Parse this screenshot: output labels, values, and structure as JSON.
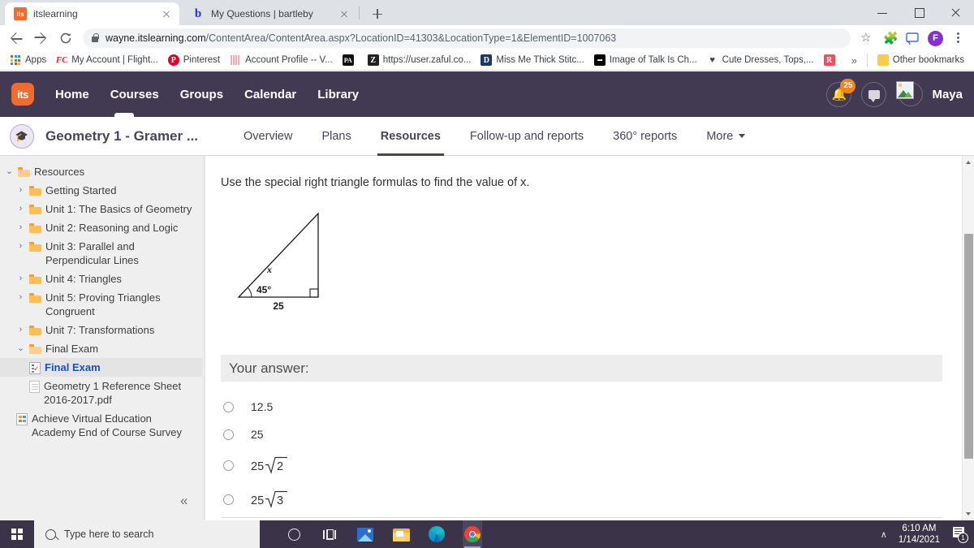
{
  "browser": {
    "tabs": [
      {
        "title": "itslearning",
        "favicon": "its-favicon",
        "active": true
      },
      {
        "title": "My Questions | bartleby",
        "favicon": "bartleby-favicon",
        "active": false
      }
    ],
    "new_tab_label": "+",
    "url_domain": "wayne.itslearning.com",
    "url_path": "/ContentArea/ContentArea.aspx?LocationID=41303&LocationType=1&ElementID=1007063",
    "profile_initial": "F",
    "bookmarks": [
      {
        "label": "Apps",
        "icon": "apps-grid-icon"
      },
      {
        "label": "My Account | Flight...",
        "icon": "fc-icon"
      },
      {
        "label": "Pinterest",
        "icon": "pinterest-icon"
      },
      {
        "label": "Account Profile -- V...",
        "icon": "stripes-icon"
      },
      {
        "label": "",
        "icon": "pa-icon"
      },
      {
        "label": "https://user.zaful.co...",
        "icon": "z-icon"
      },
      {
        "label": "Miss Me Thick Stitc...",
        "icon": "d-icon"
      },
      {
        "label": "Image of Talk Is Ch...",
        "icon": "black-icon"
      },
      {
        "label": "Cute Dresses, Tops,...",
        "icon": "v-icon"
      },
      {
        "label": "",
        "icon": "r-icon"
      }
    ],
    "overflow_label": "»",
    "other_bookmarks_label": "Other bookmarks"
  },
  "app_header": {
    "logo_text": "its",
    "nav": [
      "Home",
      "Courses",
      "Groups",
      "Calendar",
      "Library"
    ],
    "notification_count": "25",
    "username": "Maya"
  },
  "course_bar": {
    "title": "Geometry 1 - Gramer ...",
    "tabs": [
      {
        "label": "Overview",
        "active": false
      },
      {
        "label": "Plans",
        "active": false
      },
      {
        "label": "Resources",
        "active": true
      },
      {
        "label": "Follow-up and reports",
        "active": false
      },
      {
        "label": "360° reports",
        "active": false
      },
      {
        "label": "More",
        "active": false,
        "has_caret": true
      }
    ]
  },
  "sidebar": {
    "items": [
      {
        "label": "Resources",
        "level": 1,
        "type": "folder-open",
        "twisty": "⌄",
        "selected": false
      },
      {
        "label": "Getting Started",
        "level": 2,
        "type": "folder",
        "twisty": "›",
        "selected": false
      },
      {
        "label": "Unit 1: The Basics of Geometry",
        "level": 2,
        "type": "folder",
        "twisty": "›",
        "selected": false
      },
      {
        "label": "Unit 2: Reasoning and Logic",
        "level": 2,
        "type": "folder",
        "twisty": "›",
        "selected": false
      },
      {
        "label": "Unit 3: Parallel and Perpendicular Lines",
        "level": 2,
        "type": "folder",
        "twisty": "›",
        "selected": false
      },
      {
        "label": "Unit 4: Triangles",
        "level": 2,
        "type": "folder",
        "twisty": "›",
        "selected": false
      },
      {
        "label": "Unit 5: Proving Triangles Congruent",
        "level": 2,
        "type": "folder",
        "twisty": "›",
        "selected": false
      },
      {
        "label": "Unit 7: Transformations",
        "level": 2,
        "type": "folder",
        "twisty": "›",
        "selected": false
      },
      {
        "label": "Final Exam",
        "level": 2,
        "type": "folder-open",
        "twisty": "⌄",
        "selected": false
      },
      {
        "label": "Final Exam",
        "level": 3,
        "type": "quiz",
        "twisty": "",
        "selected": true,
        "link": true
      },
      {
        "label": "Geometry 1 Reference Sheet 2016-2017.pdf",
        "level": 3,
        "type": "document",
        "twisty": "",
        "selected": false
      },
      {
        "label": "Achieve Virtual Education Academy End of Course Survey",
        "level": 2,
        "type": "survey",
        "twisty": "",
        "selected": false
      }
    ],
    "collapse_icon": "«"
  },
  "question": {
    "prompt": "Use the special right triangle formulas to find the value of x.",
    "diagram": {
      "hypotenuse_label": "x",
      "angle_label": "45°",
      "base_label": "25",
      "right_angle_marker": true
    },
    "answer_header": "Your answer:",
    "options": [
      {
        "label": "12.5",
        "type": "plain",
        "selected": false
      },
      {
        "label": "25",
        "type": "plain",
        "selected": false
      },
      {
        "label": "25√2",
        "type": "radical",
        "coefficient": "25",
        "radicand": "2",
        "selected": false
      },
      {
        "label": "25√3",
        "type": "radical",
        "coefficient": "25",
        "radicand": "3",
        "selected": false
      }
    ]
  },
  "taskbar": {
    "search_placeholder": "Type here to search",
    "apps": [
      "cortana-icon",
      "task-view-icon",
      "photos-icon",
      "file-explorer-icon",
      "edge-icon",
      "chrome-icon"
    ],
    "tray_chevron": "∧",
    "time": "6:10 AM",
    "date": "1/14/2021",
    "notification_count": "1"
  },
  "colors": {
    "app_header_bg": "#413a52",
    "accent_orange": "#ef6c2e",
    "link_blue": "#1b52b0",
    "taskbar_bg": "#3b3348"
  }
}
